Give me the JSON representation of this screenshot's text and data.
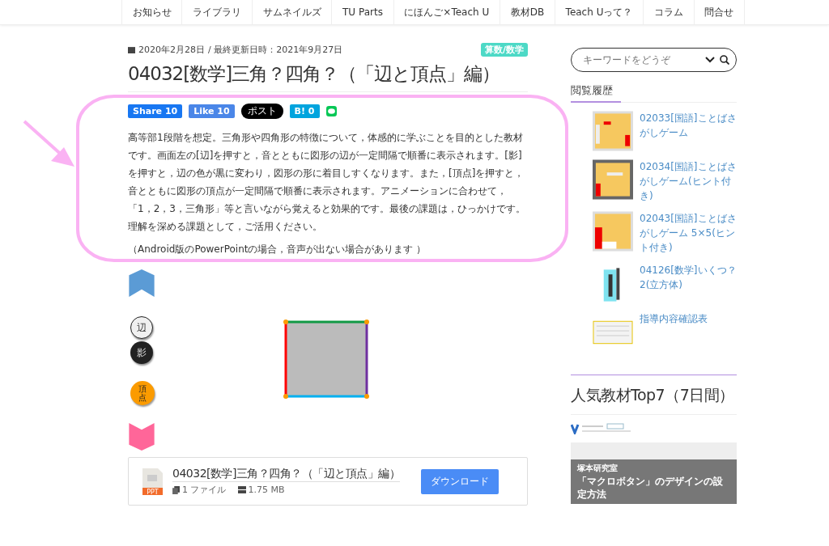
{
  "nav": {
    "items": [
      {
        "label": "お知らせ"
      },
      {
        "label": "ライブラリ"
      },
      {
        "label": "サムネイルズ"
      },
      {
        "label": "TU Parts"
      },
      {
        "label": "にほんご×Teach U"
      },
      {
        "label": "教材DB"
      },
      {
        "label": "Teach Uって？"
      },
      {
        "label": "コラム"
      },
      {
        "label": "問合せ"
      }
    ]
  },
  "article": {
    "date": "2020年2月28日",
    "updated": "/ 最終更新日時：2021年9月27日",
    "category": "算数/数学",
    "title": "04032[数学]三角？四角？（「辺と頂点」編）",
    "share": [
      {
        "kind": "facebook",
        "label": "Share 10"
      },
      {
        "kind": "like",
        "label": "Like 10"
      },
      {
        "kind": "x",
        "label": "ポスト"
      },
      {
        "kind": "hatena",
        "label": "B! 0"
      },
      {
        "kind": "line"
      }
    ],
    "paragraphs": [
      "高等部1段階を想定。三角形や四角形の特徴について，体感的に学ぶことを目的とした教材です。画面左の[辺]を押すと，音とともに図形の辺が一定間隔で順番に表示されます。[影]を押すと，辺の色が黒に変わり，図形の形に着目しすくなります。また，[頂点]を押すと，音とともに図形の頂点が一定間隔で順番に表示されます。アニメーションに合わせて，「1，2，3，三角形」等と言いながら覚えると効果的です。最後の課題は，ひっかけです。理解を深める課題として，ご活用ください。",
      "（Android版のPowerPointの場合，音声が出ない場合があります ）"
    ],
    "slide": {
      "buttons": [
        {
          "kind": "edge",
          "label": "辺"
        },
        {
          "kind": "shadow",
          "label": "影"
        },
        {
          "kind": "vertex",
          "label": "頂点"
        }
      ]
    },
    "download": {
      "file_type": "PPT",
      "title": "04032[数学]三角？四角？（「辺と頂点」編）",
      "files": "1 ファイル",
      "size": "1.75 MB",
      "button": "ダウンロード"
    }
  },
  "sidebar": {
    "search": {
      "placeholder": "キーワードをどうぞ"
    },
    "history": {
      "heading": "閲覧履歴",
      "items": [
        {
          "kind": "grid",
          "title": "02033[国語]ことばさがしゲーム"
        },
        {
          "kind": "grid-dark",
          "title": "02034[国語]ことばさがしゲーム(ヒント付き)"
        },
        {
          "kind": "grid-large",
          "title": "02043[国語]ことばさがしゲーム 5×5(ヒント付き)"
        },
        {
          "kind": "cube",
          "title": "04126[数学]いくつ？2(立方体)"
        },
        {
          "kind": "sheet",
          "title": "指導内容確認表"
        }
      ]
    },
    "popular": {
      "heading": "人気教材Top7（7日間）",
      "card": {
        "author": "塚本研究室",
        "title": "「マクロボタン」のデザインの設定方法"
      }
    }
  }
}
